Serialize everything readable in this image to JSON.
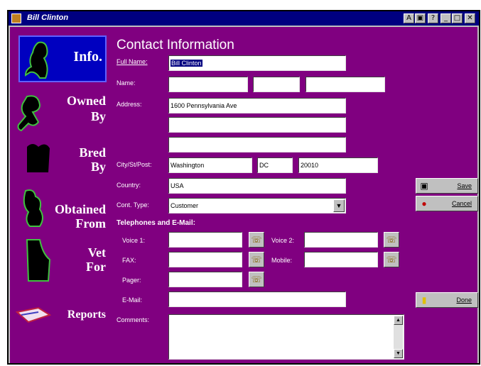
{
  "window": {
    "title": "Bill Clinton",
    "buttons": [
      "A",
      "▣",
      "?",
      "_",
      "□",
      "✕"
    ]
  },
  "nav": {
    "info": "Info.",
    "owned_by": [
      "Owned",
      "By"
    ],
    "bred_by": [
      "Bred",
      "By"
    ],
    "obtained_from": [
      "Obtained",
      "From"
    ],
    "vet_for": [
      "Vet",
      "For"
    ],
    "reports": "Reports"
  },
  "form": {
    "heading": "Contact Information",
    "labels": {
      "full_name": "Full Name:",
      "name": "Name:",
      "address": "Address:",
      "city_st_post": "City/St/Post:",
      "country": "Country:",
      "cont_type": "Cont. Type:",
      "section_phones": "Telephones and E-Mail:",
      "voice1": "Voice 1:",
      "voice2": "Voice 2:",
      "fax": "FAX:",
      "mobile": "Mobile:",
      "pager": "Pager:",
      "email": "E-Mail:",
      "comments": "Comments:"
    },
    "values": {
      "full_name": "Bill Clinton",
      "name_first": "",
      "name_middle": "",
      "name_last": "",
      "address1": "1600 Pennsylvania Ave",
      "address2": "",
      "address3": "",
      "city": "Washington",
      "state": "DC",
      "postcode": "20010",
      "country": "USA",
      "cont_type": "Customer",
      "voice1": "",
      "voice2": "",
      "fax": "",
      "mobile": "",
      "pager": "",
      "email": "",
      "comments": ""
    }
  },
  "buttons": {
    "save": "Save",
    "cancel": "Cancel",
    "done": "Done"
  },
  "icons": {
    "phone_dial": "phone-dial-icon",
    "save": "floppy-icon",
    "cancel": "cancel-icon",
    "done": "door-icon"
  }
}
